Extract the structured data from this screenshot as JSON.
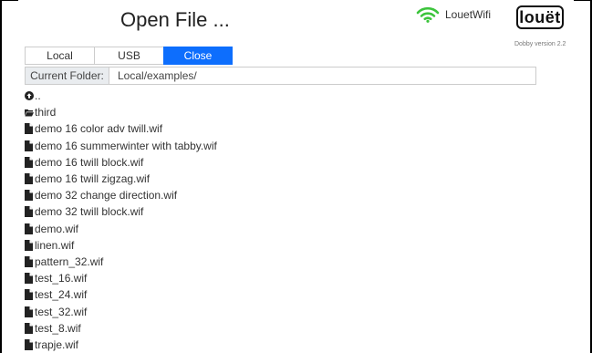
{
  "header": {
    "title": "Open File ...",
    "wifi_label": "LouetWifi",
    "logo_text": "louët",
    "version": "Dobby version 2.2"
  },
  "source_buttons": {
    "local": "Local",
    "usb": "USB",
    "close": "Close"
  },
  "folder": {
    "label": "Current Folder:",
    "value": "Local/examples/"
  },
  "files": [
    {
      "name": "..",
      "icon": "parent-dir-icon"
    },
    {
      "name": "third",
      "icon": "folder-icon"
    },
    {
      "name": "demo 16 color adv twill.wif",
      "icon": "file-icon"
    },
    {
      "name": "demo 16 summerwinter with tabby.wif",
      "icon": "file-icon"
    },
    {
      "name": "demo 16 twill block.wif",
      "icon": "file-icon"
    },
    {
      "name": "demo 16 twill zigzag.wif",
      "icon": "file-icon"
    },
    {
      "name": "demo 32 change direction.wif",
      "icon": "file-icon"
    },
    {
      "name": "demo 32 twill block.wif",
      "icon": "file-icon"
    },
    {
      "name": "demo.wif",
      "icon": "file-icon"
    },
    {
      "name": "linen.wif",
      "icon": "file-icon"
    },
    {
      "name": "pattern_32.wif",
      "icon": "file-icon"
    },
    {
      "name": "test_16.wif",
      "icon": "file-icon"
    },
    {
      "name": "test_24.wif",
      "icon": "file-icon"
    },
    {
      "name": "test_32.wif",
      "icon": "file-icon"
    },
    {
      "name": "test_8.wif",
      "icon": "file-icon"
    },
    {
      "name": "trapje.wif",
      "icon": "file-icon"
    }
  ],
  "colors": {
    "accent": "#0d6efd",
    "wifi": "#3cc43c"
  }
}
